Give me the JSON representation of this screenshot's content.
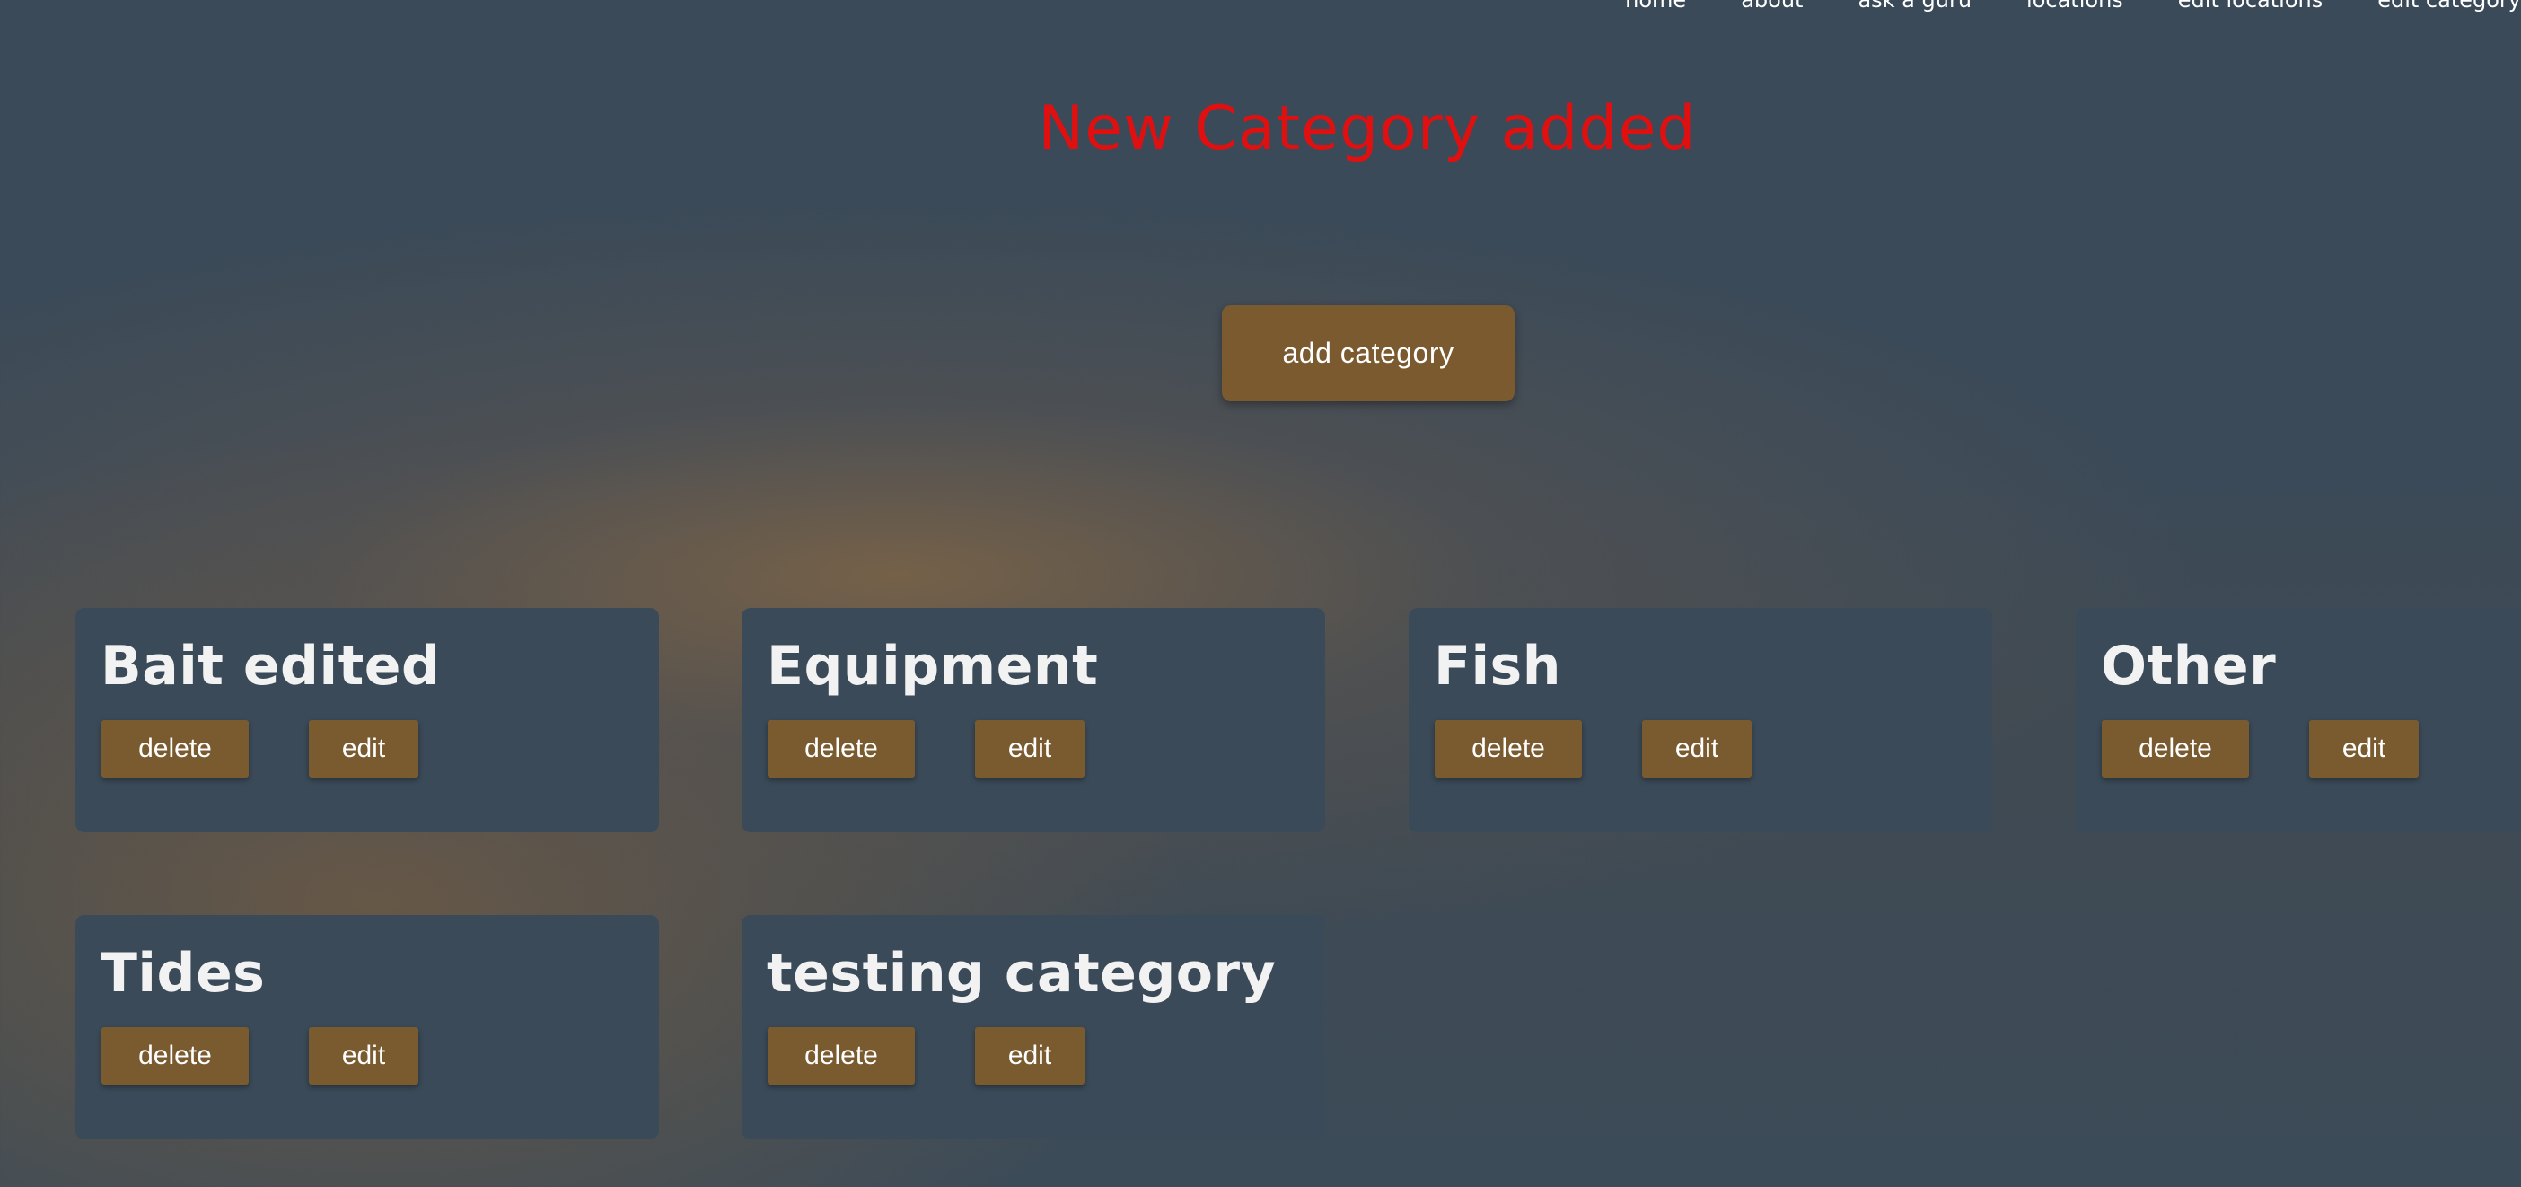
{
  "nav": {
    "items": [
      "home",
      "about",
      "ask a guru",
      "locations",
      "edit locations",
      "edit category"
    ]
  },
  "flash_message": "New Category added",
  "add_button_label": "add category",
  "categories": [
    {
      "name": "Bait edited",
      "delete_label": "delete",
      "edit_label": "edit"
    },
    {
      "name": "Equipment",
      "delete_label": "delete",
      "edit_label": "edit"
    },
    {
      "name": "Fish",
      "delete_label": "delete",
      "edit_label": "edit"
    },
    {
      "name": "Other",
      "delete_label": "delete",
      "edit_label": "edit"
    },
    {
      "name": "Tides",
      "delete_label": "delete",
      "edit_label": "edit"
    },
    {
      "name": "testing category",
      "delete_label": "delete",
      "edit_label": "edit"
    }
  ],
  "colors": {
    "background": "#3a4a58",
    "card": "#3a4a58",
    "button": "#7a5a2f",
    "flash": "#e01010"
  }
}
